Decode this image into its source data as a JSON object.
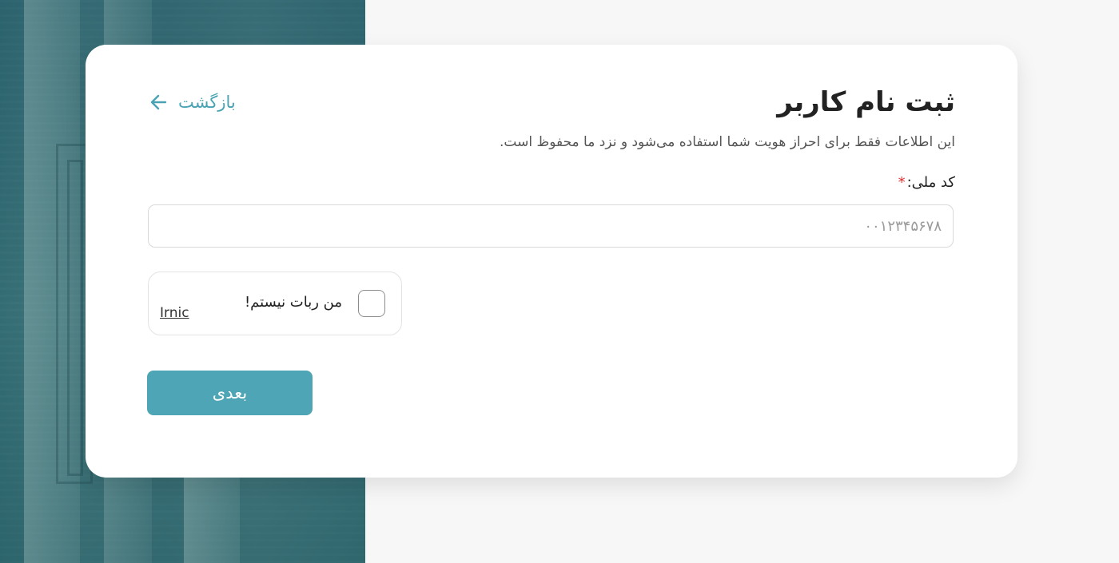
{
  "page": {
    "title": "ثبت نام کاربر",
    "subtitle": "این اطلاعات فقط برای احراز هویت شما استفاده می‌شود و نزد ما محفوظ است.",
    "back": {
      "label": "بازگشت",
      "icon": "arrow-left-icon"
    }
  },
  "form": {
    "national_code": {
      "label": "کد ملی:",
      "required_mark": "*",
      "value": "",
      "placeholder": "۰۰۱۲۳۴۵۶۷۸"
    },
    "captcha": {
      "label": "من ربات نیستم!",
      "brand": "Irnic",
      "checked": false
    },
    "submit_label": "بعدی"
  },
  "colors": {
    "accent": "#4ea5b5",
    "link": "#4aa3b3",
    "required": "#dd3333",
    "background": "#f7f7f7"
  }
}
